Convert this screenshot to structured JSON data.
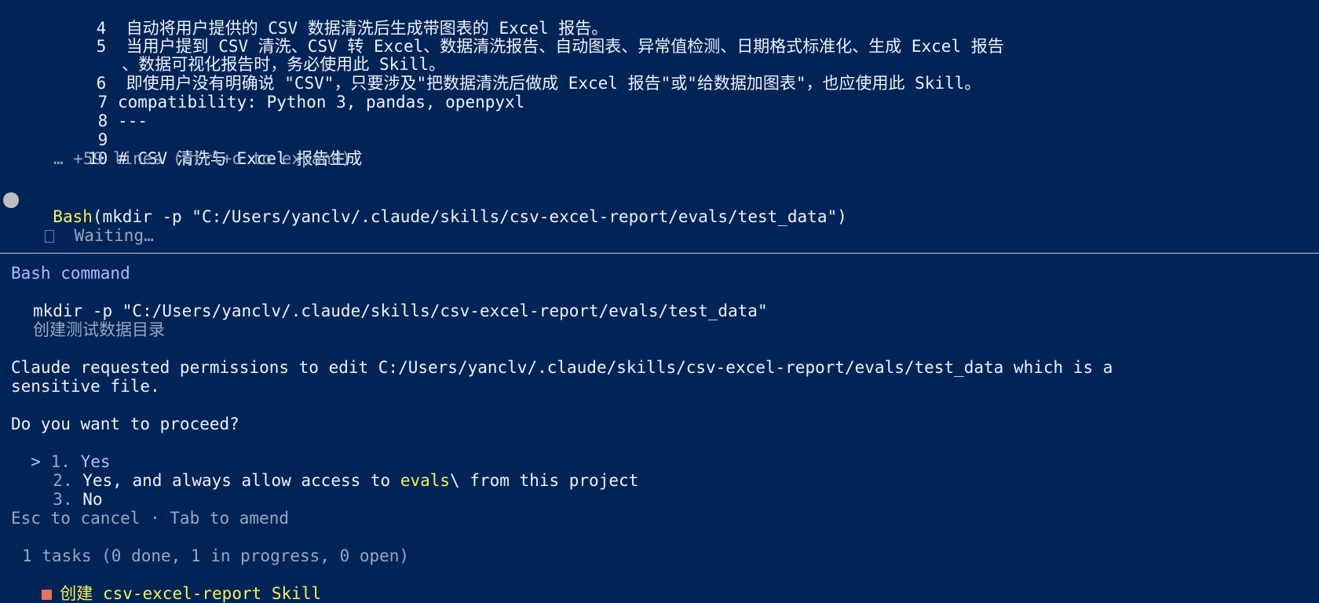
{
  "file_preview": {
    "lines": [
      {
        "num": "4",
        "text": "  自动将用户提供的 CSV 数据清洗后生成带图表的 Excel 报告。"
      },
      {
        "num": "5",
        "text": "  当用户提到 CSV 清洗、CSV 转 Excel、数据清洗报告、自动图表、异常值检测、日期格式标准化、生成 Excel 报告"
      },
      {
        "num": "",
        "text": "、数据可视化报告时，务必使用此 Skill。"
      },
      {
        "num": "6",
        "text": "  即使用户没有明确说 \"CSV\"，只要涉及\"把数据清洗后做成 Excel 报告\"或\"给数据加图表\"，也应使用此 Skill。"
      },
      {
        "num": "7",
        "text": "compatibility: Python 3, pandas, openpyxl"
      },
      {
        "num": "8",
        "text": "---"
      },
      {
        "num": "9",
        "text": ""
      },
      {
        "num": "10",
        "text": "# CSV 清洗与 Excel 报告生成"
      }
    ],
    "expand_hint": "… +59 lines (ctrl+o to expand)"
  },
  "tool_call": {
    "tool": "Bash",
    "args": "(mkdir -p \"C:/Users/yanclv/.claude/skills/csv-excel-report/evals/test_data\")",
    "status": "Waiting…"
  },
  "prompt": {
    "header": "Bash command",
    "command": "mkdir -p \"C:/Users/yanclv/.claude/skills/csv-excel-report/evals/test_data\"",
    "description": "创建测试数据目录",
    "permission_line1": "Claude requested permissions to edit C:/Users/yanclv/.claude/skills/csv-excel-report/evals/test_data which is a",
    "permission_line2": "sensitive file.",
    "question": "Do you want to proceed?",
    "cursor": ">",
    "options": [
      {
        "num": "1.",
        "label": "Yes"
      },
      {
        "num": "2.",
        "pre": "Yes, and always allow access to ",
        "highlight": "evals",
        "post": "\\ from this project"
      },
      {
        "num": "3.",
        "label": "No"
      }
    ],
    "footer": "Esc to cancel · Tab to amend"
  },
  "tasks": {
    "summary": "1 tasks (0 done, 1 in progress, 0 open)",
    "item_prefix": "创建 ",
    "item_name": "csv-excel-report Skill"
  },
  "colors": {
    "background": "#012456",
    "accent_yellow": "#f2f25a",
    "header_lavender": "#b5b8ff",
    "task_square": "#e8735b"
  }
}
